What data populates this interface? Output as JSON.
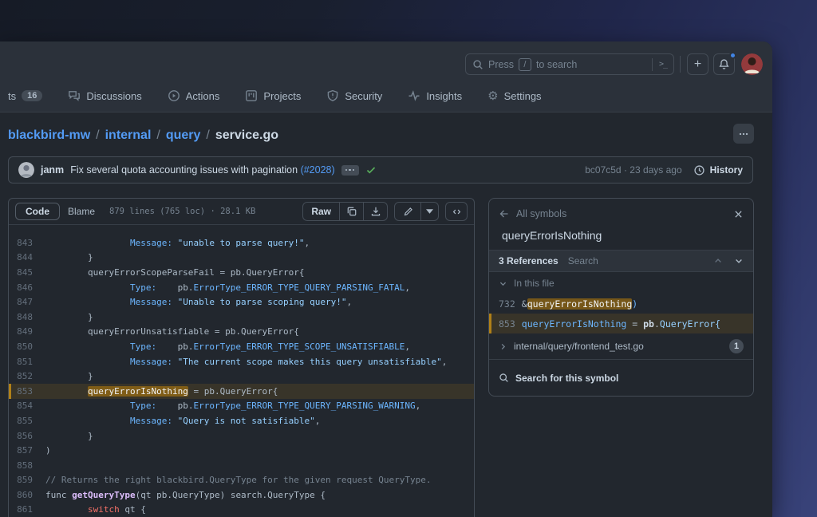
{
  "colors": {
    "accent": "#539bf5",
    "attention": "#c69026",
    "success": "#57ab5a",
    "notification_dot": "#4184e4"
  },
  "header": {
    "search": {
      "prefix": "Press",
      "key": "/",
      "suffix": "to search"
    },
    "plus_label": "+"
  },
  "nav": {
    "tabs": [
      {
        "label": "ts",
        "count": "16"
      },
      {
        "label": "Discussions"
      },
      {
        "label": "Actions"
      },
      {
        "label": "Projects"
      },
      {
        "label": "Security"
      },
      {
        "label": "Insights"
      },
      {
        "label": "Settings"
      }
    ]
  },
  "breadcrumb": {
    "repo": "blackbird-mw",
    "sep": "/",
    "dir1": "internal",
    "dir2": "query",
    "file": "service.go"
  },
  "commit": {
    "author": "janm",
    "message": "Fix several quota accounting issues with pagination",
    "pr": "(#2028)",
    "meta": "bc07c5d · 23 days ago",
    "history_label": "History"
  },
  "filebar": {
    "code_tab": "Code",
    "blame_tab": "Blame",
    "meta": "879 lines (765 loc) · 28.1 KB",
    "raw_label": "Raw"
  },
  "code": {
    "lines": [
      {
        "n": "843",
        "tokens": [
          [
            "d",
            "                "
          ],
          [
            "c1",
            "Message:"
          ],
          [
            "d",
            " "
          ],
          [
            "s",
            "\"unable to parse query!\""
          ],
          [
            "d",
            ","
          ]
        ]
      },
      {
        "n": "844",
        "tokens": [
          [
            "d",
            "        }"
          ]
        ]
      },
      {
        "n": "845",
        "tokens": [
          [
            "d",
            "        queryErrorScopeParseFail = pb.QueryError{"
          ]
        ]
      },
      {
        "n": "846",
        "tokens": [
          [
            "d",
            "                "
          ],
          [
            "c1",
            "Type:"
          ],
          [
            "d",
            "    pb."
          ],
          [
            "c1",
            "ErrorType_ERROR_TYPE_QUERY_PARSING_FATAL"
          ],
          [
            "d",
            ","
          ]
        ]
      },
      {
        "n": "847",
        "tokens": [
          [
            "d",
            "                "
          ],
          [
            "c1",
            "Message:"
          ],
          [
            "d",
            " "
          ],
          [
            "s",
            "\"Unable to parse scoping query!\""
          ],
          [
            "d",
            ","
          ]
        ]
      },
      {
        "n": "848",
        "tokens": [
          [
            "d",
            "        }"
          ]
        ]
      },
      {
        "n": "849",
        "tokens": [
          [
            "d",
            "        queryErrorUnsatisfiable = pb.QueryError{"
          ]
        ]
      },
      {
        "n": "850",
        "tokens": [
          [
            "d",
            "                "
          ],
          [
            "c1",
            "Type:"
          ],
          [
            "d",
            "    pb."
          ],
          [
            "c1",
            "ErrorType_ERROR_TYPE_SCOPE_UNSATISFIABLE"
          ],
          [
            "d",
            ","
          ]
        ]
      },
      {
        "n": "851",
        "tokens": [
          [
            "d",
            "                "
          ],
          [
            "c1",
            "Message:"
          ],
          [
            "d",
            " "
          ],
          [
            "s",
            "\"The current scope makes this query unsatisfiable\""
          ],
          [
            "d",
            ","
          ]
        ]
      },
      {
        "n": "852",
        "tokens": [
          [
            "d",
            "        }"
          ]
        ]
      },
      {
        "n": "853",
        "hl": true,
        "tokens": [
          [
            "d",
            "        "
          ],
          [
            "hl",
            "queryErrorIsNothing"
          ],
          [
            "d",
            " = pb.QueryError{"
          ]
        ]
      },
      {
        "n": "854",
        "tokens": [
          [
            "d",
            "                "
          ],
          [
            "c1",
            "Type:"
          ],
          [
            "d",
            "    pb."
          ],
          [
            "c1",
            "ErrorType_ERROR_TYPE_QUERY_PARSING_WARNING"
          ],
          [
            "d",
            ","
          ]
        ]
      },
      {
        "n": "855",
        "tokens": [
          [
            "d",
            "                "
          ],
          [
            "c1",
            "Message:"
          ],
          [
            "d",
            " "
          ],
          [
            "s",
            "\"Query is not satisfiable\""
          ],
          [
            "d",
            ","
          ]
        ]
      },
      {
        "n": "856",
        "tokens": [
          [
            "d",
            "        }"
          ]
        ]
      },
      {
        "n": "857",
        "tokens": [
          [
            "d",
            ")"
          ]
        ]
      },
      {
        "n": "858",
        "tokens": []
      },
      {
        "n": "859",
        "tokens": [
          [
            "c",
            "// Returns the right blackbird.QueryType for the given request QueryType."
          ]
        ]
      },
      {
        "n": "860",
        "tokens": [
          [
            "d",
            "func "
          ],
          [
            "en",
            "getQueryType"
          ],
          [
            "d",
            "(qt pb.QueryType) search.QueryType {"
          ]
        ]
      },
      {
        "n": "861",
        "tokens": [
          [
            "d",
            "        "
          ],
          [
            "k",
            "switch"
          ],
          [
            "d",
            " qt {"
          ]
        ]
      }
    ]
  },
  "symbols": {
    "back_label": "All symbols",
    "symbol": "queryErrorIsNothing",
    "refs_count": "3 References",
    "refs_search": "Search",
    "group_label": "In this file",
    "rows": [
      {
        "line": "732",
        "selected": false,
        "tokens": [
          [
            "d",
            "&"
          ],
          [
            "hl",
            "queryErrorIsNothing"
          ],
          [
            "c1",
            ")"
          ]
        ]
      },
      {
        "line": "853",
        "selected": true,
        "tokens": [
          [
            "c1",
            "queryErrorIsNothing"
          ],
          [
            "d",
            " = "
          ],
          [
            "b",
            "pb"
          ],
          [
            "d",
            "."
          ],
          [
            "s",
            "QueryError{"
          ]
        ]
      }
    ],
    "file_ref": {
      "path": "internal/query/frontend_test.go",
      "count": "1"
    },
    "footer_label": "Search for this symbol"
  }
}
